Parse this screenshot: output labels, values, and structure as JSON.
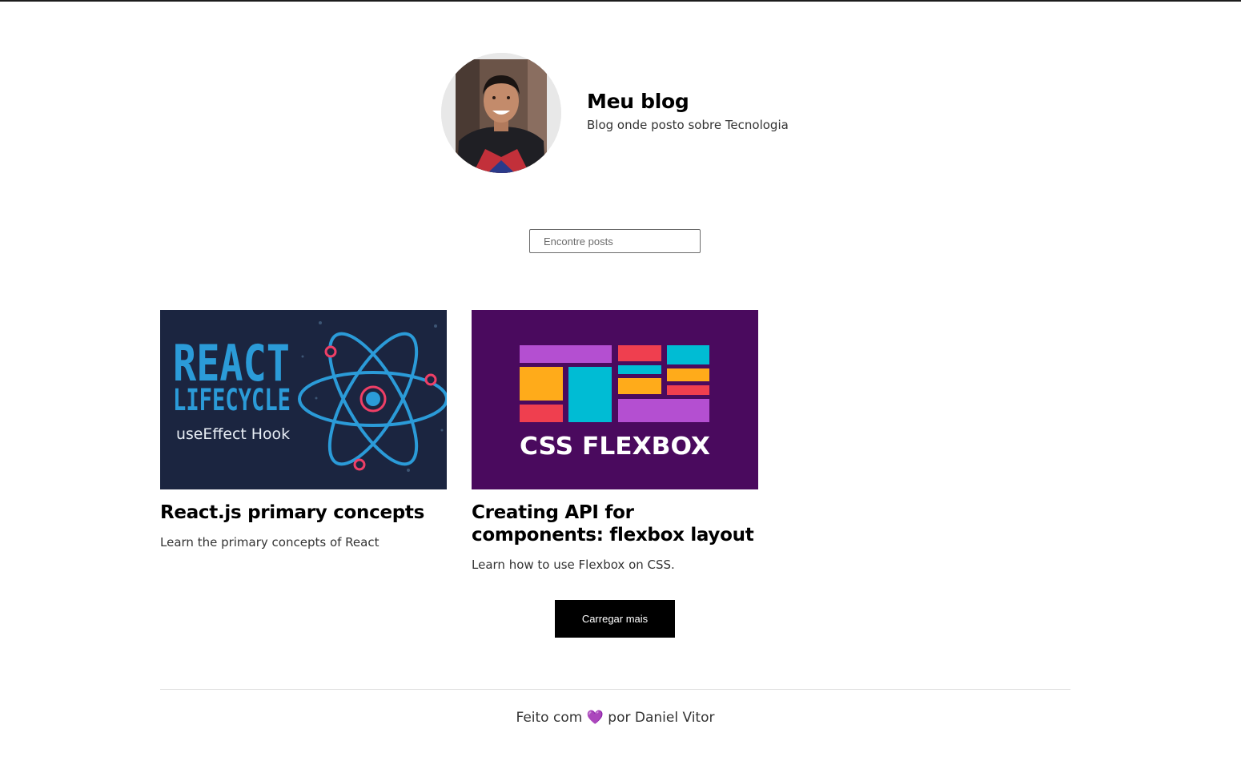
{
  "profile": {
    "title": "Meu blog",
    "description": "Blog onde posto sobre Tecnologia"
  },
  "search": {
    "placeholder": "Encontre posts"
  },
  "posts": [
    {
      "title": "React.js primary concepts",
      "excerpt": "Learn the primary concepts of React",
      "cover": {
        "line1": "REACT",
        "line2": "LIFECYCLE",
        "line3": "useEffect Hook",
        "background": "#1b2540",
        "accent": "#2b9bd8"
      }
    },
    {
      "title": "Creating API for components: flexbox layout",
      "excerpt": "Learn how to use Flexbox on CSS.",
      "cover": {
        "caption": "CSS FLEXBOX",
        "background": "#4a0a5e"
      }
    }
  ],
  "load_more_label": "Carregar mais",
  "footer": {
    "before": "Feito com",
    "heart": "💜",
    "after": "por Daniel Vitor"
  },
  "colors": {
    "purple": "#b44fd1",
    "red": "#ef3f4f",
    "cyan": "#00bcd4",
    "orange": "#ffab1a"
  }
}
